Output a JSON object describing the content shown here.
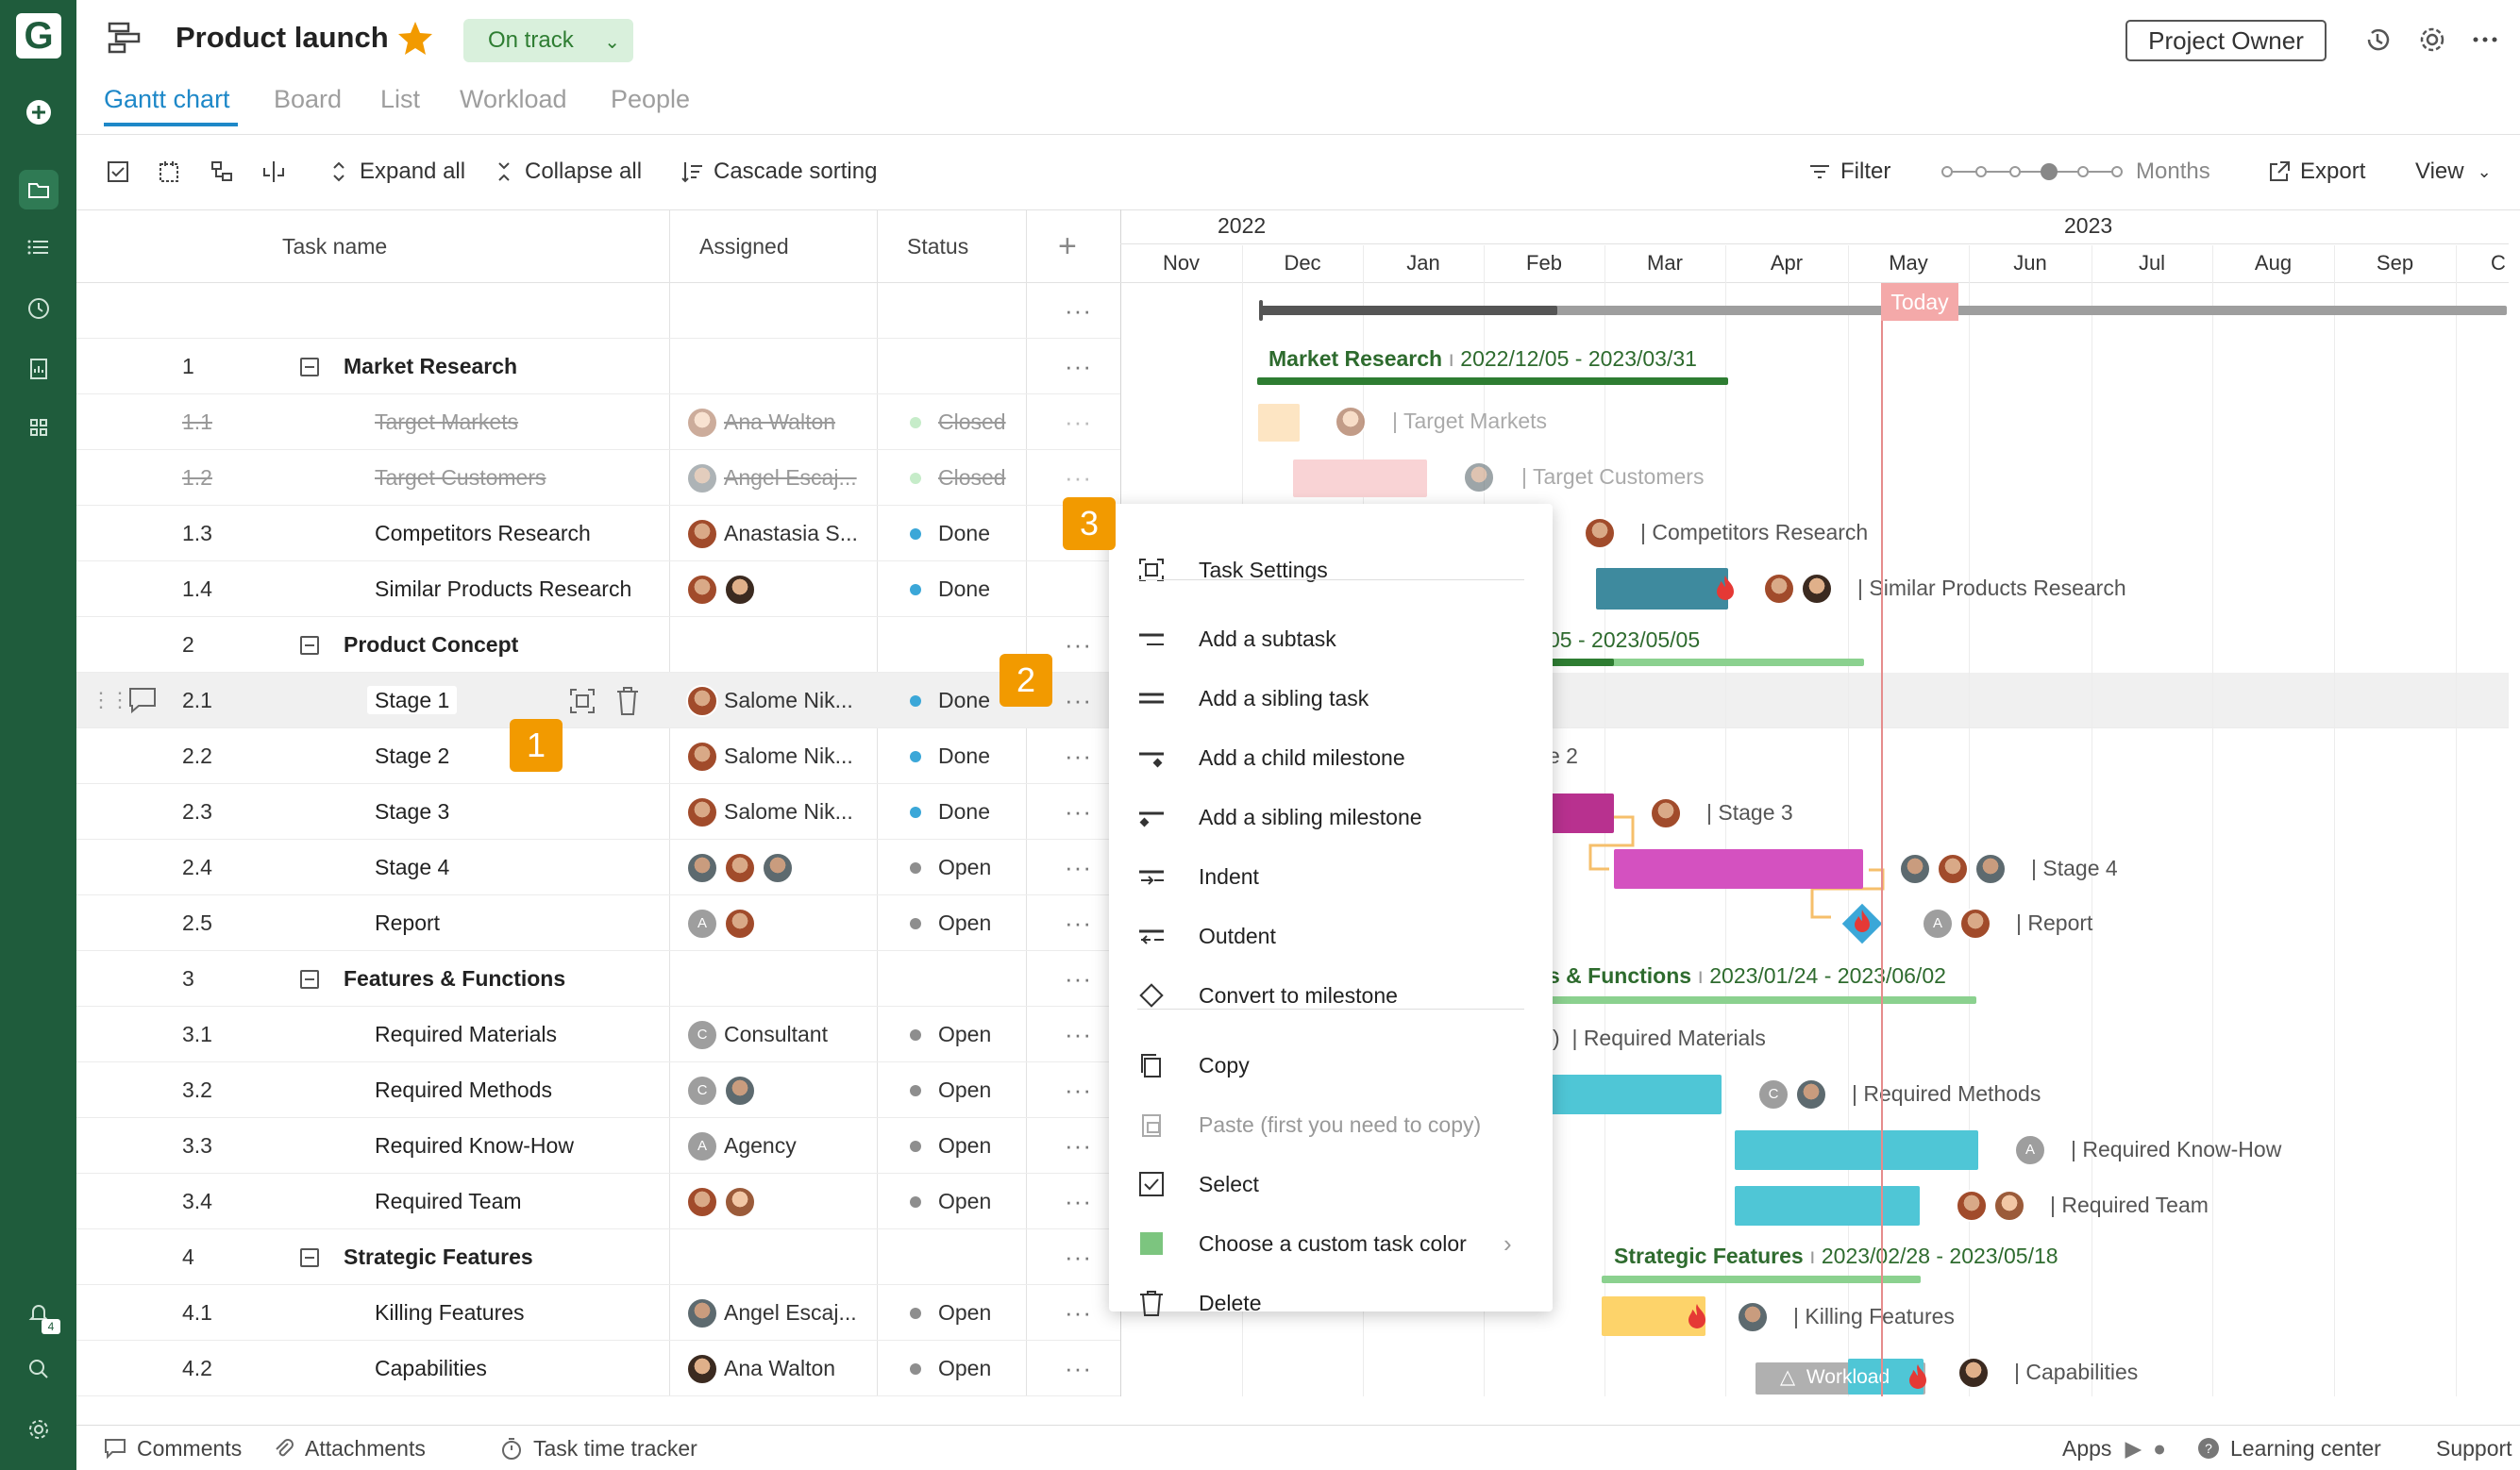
{
  "app": {
    "logo": "G"
  },
  "header": {
    "title": "Product launch",
    "status": "On track",
    "project_owner": "Project Owner"
  },
  "tabs": [
    "Gantt chart",
    "Board",
    "List",
    "Workload",
    "People"
  ],
  "toolbar": {
    "expand_all": "Expand all",
    "collapse_all": "Collapse all",
    "cascade_sorting": "Cascade sorting",
    "filter": "Filter",
    "zoom_label": "Months",
    "export": "Export",
    "view": "View"
  },
  "grid": {
    "col_task": "Task name",
    "col_assigned": "Assigned",
    "col_status": "Status"
  },
  "timeline": {
    "years": [
      "2022",
      "2023"
    ],
    "months": [
      "Nov",
      "Dec",
      "Jan",
      "Feb",
      "Mar",
      "Apr",
      "May",
      "Jun",
      "Jul",
      "Aug",
      "Sep",
      "C"
    ],
    "today": "Today"
  },
  "rows": [
    {
      "num": "1",
      "name": "Market Research",
      "group": true
    },
    {
      "num": "1.1",
      "name": "Target Markets",
      "assigned": "Ana Walton",
      "status": "Closed",
      "closed": true
    },
    {
      "num": "1.2",
      "name": "Target Customers",
      "assigned": "Angel Escaj...",
      "status": "Closed",
      "closed": true
    },
    {
      "num": "1.3",
      "name": "Competitors Research",
      "assigned": "Anastasia S...",
      "status": "Done"
    },
    {
      "num": "1.4",
      "name": "Similar Products Research",
      "assigned": "",
      "status": "Done"
    },
    {
      "num": "2",
      "name": "Product Concept",
      "group": true
    },
    {
      "num": "2.1",
      "name": "Stage 1",
      "assigned": "Salome Nik...",
      "status": "Done"
    },
    {
      "num": "2.2",
      "name": "Stage 2",
      "assigned": "Salome Nik...",
      "status": "Done"
    },
    {
      "num": "2.3",
      "name": "Stage 3",
      "assigned": "Salome Nik...",
      "status": "Done"
    },
    {
      "num": "2.4",
      "name": "Stage 4",
      "assigned": "",
      "status": "Open"
    },
    {
      "num": "2.5",
      "name": "Report",
      "assigned": "",
      "status": "Open"
    },
    {
      "num": "3",
      "name": "Features & Functions",
      "group": true
    },
    {
      "num": "3.1",
      "name": "Required Materials",
      "assigned": "Consultant",
      "status": "Open"
    },
    {
      "num": "3.2",
      "name": "Required Methods",
      "assigned": "",
      "status": "Open"
    },
    {
      "num": "3.3",
      "name": "Required Know-How",
      "assigned": "Agency",
      "status": "Open"
    },
    {
      "num": "3.4",
      "name": "Required Team",
      "assigned": "",
      "status": "Open"
    },
    {
      "num": "4",
      "name": "Strategic Features",
      "group": true
    },
    {
      "num": "4.1",
      "name": "Killing Features",
      "assigned": "Angel Escaj...",
      "status": "Open"
    },
    {
      "num": "4.2",
      "name": "Capabilities",
      "assigned": "Ana Walton",
      "status": "Open"
    }
  ],
  "avatar_initials": {
    "a": "A",
    "c": "C"
  },
  "gantt": {
    "market_research": {
      "name": "Market Research",
      "dates": "2022/12/05 - 2023/03/31"
    },
    "target_markets": "Target Markets",
    "target_customers": "Target Customers",
    "competitors_research": "Competitors Research",
    "similar_products": "Similar Products Research",
    "product_concept_dates": "05 - 2023/05/05",
    "stage2_partial": "e 2",
    "stage3": "Stage 3",
    "stage4": "Stage 4",
    "report": "Report",
    "features_functions": {
      "name": "s & Functions",
      "dates": "2023/01/24 - 2023/06/02"
    },
    "required_materials": "Required Materials",
    "required_methods": "Required Methods",
    "required_knowhow": "Required Know-How",
    "required_team": "Required Team",
    "strategic_features": {
      "name": "Strategic Features",
      "dates": "2023/02/28 - 2023/05/18"
    },
    "killing_features": "Killing Features",
    "capabilities": "Capabilities",
    "workload": "Workload"
  },
  "context_menu": {
    "items": [
      "Task Settings",
      "Add a subtask",
      "Add a sibling task",
      "Add a child milestone",
      "Add a sibling milestone",
      "Indent",
      "Outdent",
      "Convert to milestone",
      "Copy",
      "Paste (first you need to copy)",
      "Select",
      "Choose a custom task color",
      "Delete"
    ]
  },
  "callouts": [
    "1",
    "2",
    "3"
  ],
  "notifications_count": "4",
  "footer": {
    "comments": "Comments",
    "attachments": "Attachments",
    "time_tracker": "Task time tracker",
    "apps": "Apps",
    "learning_center": "Learning center",
    "support": "Support"
  },
  "colors": {
    "sidebar": "#1f5c3c",
    "accent": "#1e88c8",
    "callout": "#f29a00",
    "today": "#e58c8c"
  }
}
